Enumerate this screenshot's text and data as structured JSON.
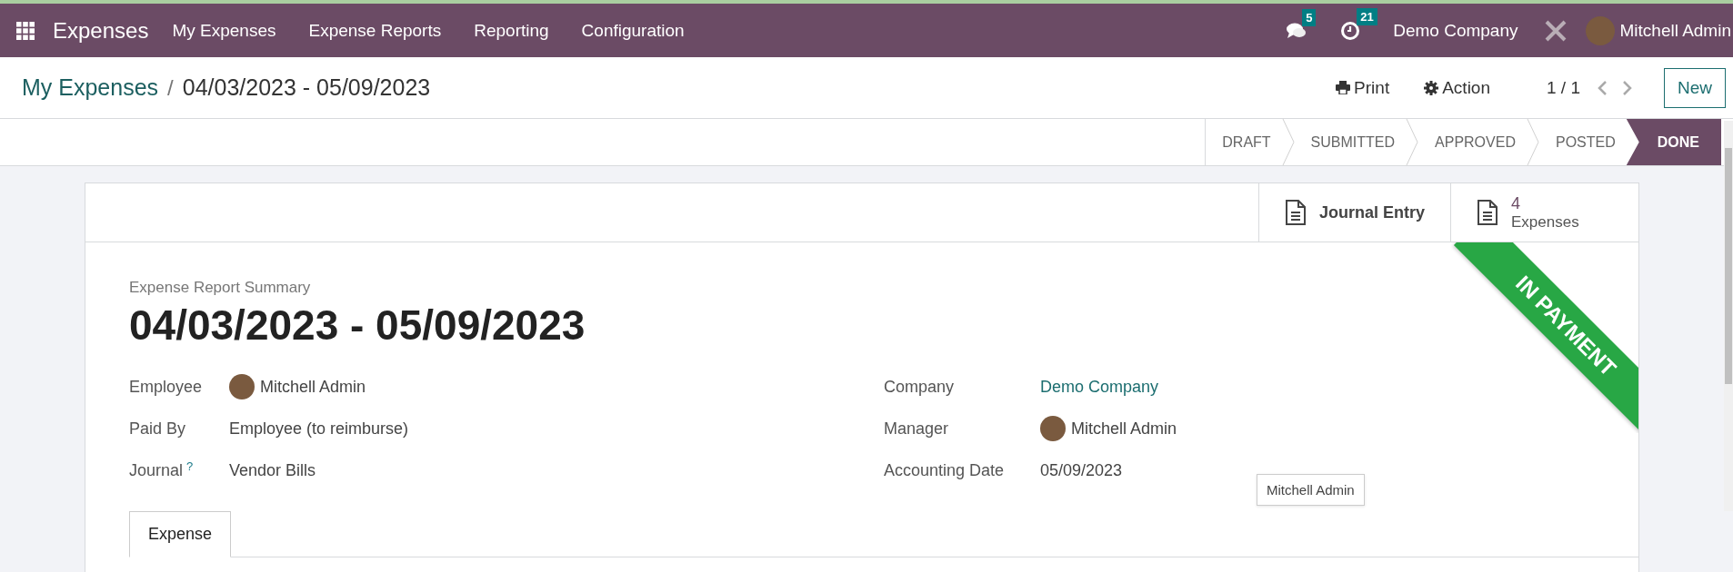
{
  "navbar": {
    "app_name": "Expenses",
    "menu": [
      "My Expenses",
      "Expense Reports",
      "Reporting",
      "Configuration"
    ],
    "messages_count": "5",
    "activities_count": "21",
    "company": "Demo Company",
    "user": "Mitchell Admin"
  },
  "breadcrumb": {
    "parent": "My Expenses",
    "separator": "/",
    "current": "04/03/2023 - 05/09/2023"
  },
  "control_panel": {
    "print": "Print",
    "action": "Action",
    "pager": "1 / 1",
    "new_button": "New"
  },
  "status_bar": [
    {
      "label": "DRAFT",
      "selected": false
    },
    {
      "label": "SUBMITTED",
      "selected": false
    },
    {
      "label": "APPROVED",
      "selected": false
    },
    {
      "label": "POSTED",
      "selected": false
    },
    {
      "label": "DONE",
      "selected": true
    }
  ],
  "smart_buttons": [
    {
      "kind": "plain",
      "label": "Journal Entry"
    },
    {
      "kind": "stat",
      "count": "4",
      "label": "Expenses"
    }
  ],
  "ribbon": "IN PAYMENT",
  "form": {
    "overline": "Expense Report Summary",
    "title": "04/03/2023 - 05/09/2023",
    "left_fields": [
      {
        "label": "Employee",
        "kind": "avatar",
        "value": "Mitchell Admin"
      },
      {
        "label": "Paid By",
        "kind": "text",
        "value": "Employee (to reimburse)"
      },
      {
        "label": "Journal",
        "help": "?",
        "kind": "text",
        "value": "Vendor Bills"
      }
    ],
    "right_fields": [
      {
        "label": "Company",
        "kind": "link",
        "value": "Demo Company"
      },
      {
        "label": "Manager",
        "kind": "avatar",
        "value": "Mitchell Admin"
      },
      {
        "label": "Accounting Date",
        "kind": "text",
        "value": "05/09/2023"
      }
    ]
  },
  "tooltip": "Mitchell Admin",
  "tabs": [
    {
      "label": "Expense",
      "selected": true
    }
  ]
}
